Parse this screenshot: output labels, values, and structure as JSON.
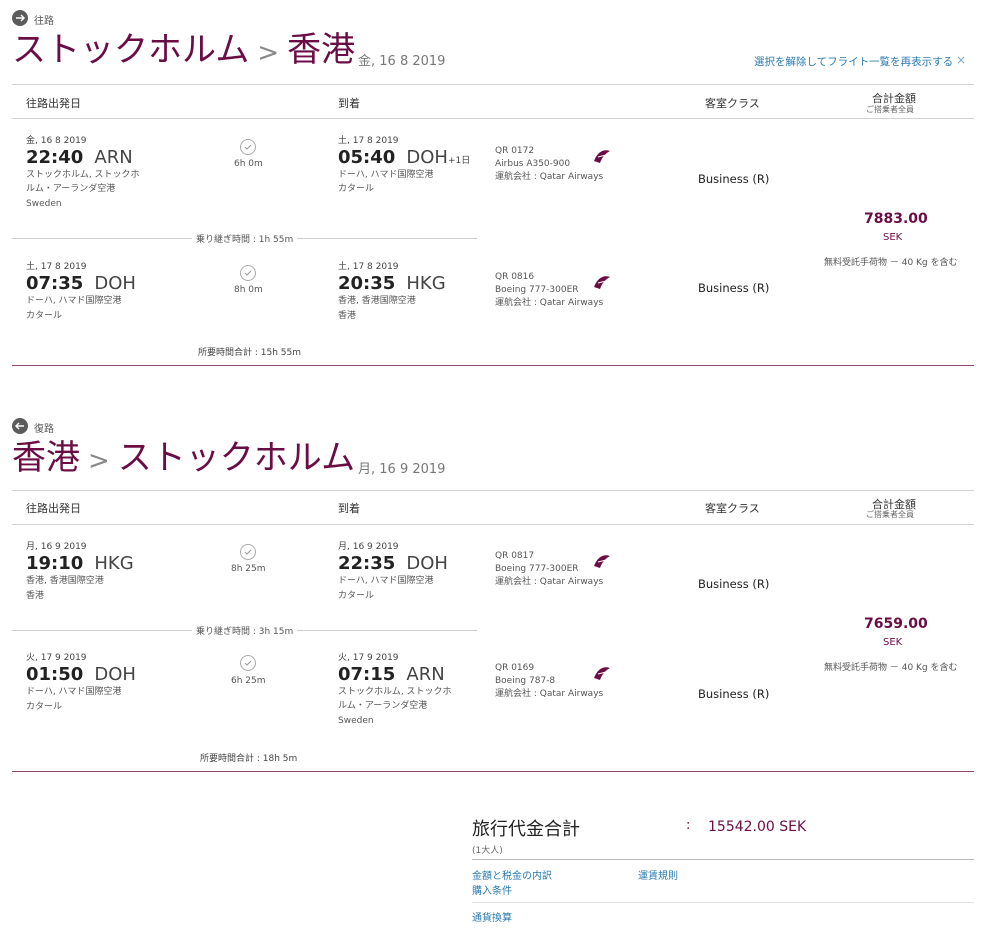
{
  "outbound": {
    "dir_label": "往路",
    "from": "ストックホルム",
    "sep": ">",
    "to": "香港",
    "date": "金, 16 8 2019",
    "reset_link": "選択を解除してフライト一覧を再表示する",
    "close": "×",
    "headers": {
      "depart": "往路出発日",
      "arrive": "到着",
      "cabin": "客室クラス",
      "total": "合計金額",
      "total_sub": "ご搭乗者全員"
    },
    "seg1": {
      "dep_date": "金, 16 8 2019",
      "dep_time": "22:40",
      "dep_code": "ARN",
      "dep_place1": "ストックホルム, ストックホ",
      "dep_place2": "ルム・アーランダ空港",
      "dep_country": "Sweden",
      "duration": "6h 0m",
      "arr_date": "土, 17 8 2019",
      "arr_time": "05:40",
      "arr_code": "DOH",
      "arr_plus": "+1日",
      "arr_place": "ドーハ, ハマド国際空港",
      "arr_country": "カタール",
      "flight_no": "QR 0172",
      "aircraft": "Airbus A350-900",
      "operator": "運航会社 : Qatar Airways",
      "cabin": "Business (R)"
    },
    "connection": "乗り継ぎ時間 : 1h 55m",
    "seg2": {
      "dep_date": "土, 17 8 2019",
      "dep_time": "07:35",
      "dep_code": "DOH",
      "dep_place1": "ドーハ, ハマド国際空港",
      "dep_country": "カタール",
      "duration": "8h 0m",
      "arr_date": "土, 17 8 2019",
      "arr_time": "20:35",
      "arr_code": "HKG",
      "arr_place": "香港, 香港国際空港",
      "arr_country": "香港",
      "flight_no": "QR 0816",
      "aircraft": "Boeing 777-300ER",
      "operator": "運航会社 : Qatar Airways",
      "cabin": "Business (R)"
    },
    "price": "7883.00",
    "currency": "SEK",
    "baggage": "無料受託手荷物 － 40 Kg を含む",
    "total_time": "所要時間合計 : 15h 55m"
  },
  "inbound": {
    "dir_label": "復路",
    "from": "香港",
    "sep": ">",
    "to": "ストックホルム",
    "date": "月, 16 9 2019",
    "headers": {
      "depart": "往路出発日",
      "arrive": "到着",
      "cabin": "客室クラス",
      "total": "合計金額",
      "total_sub": "ご搭乗者全員"
    },
    "seg1": {
      "dep_date": "月, 16 9 2019",
      "dep_time": "19:10",
      "dep_code": "HKG",
      "dep_place1": "香港, 香港国際空港",
      "dep_country": "香港",
      "duration": "8h 25m",
      "arr_date": "月, 16 9 2019",
      "arr_time": "22:35",
      "arr_code": "DOH",
      "arr_place": "ドーハ, ハマド国際空港",
      "arr_country": "カタール",
      "flight_no": "QR 0817",
      "aircraft": "Boeing 777-300ER",
      "operator": "運航会社 : Qatar Airways",
      "cabin": "Business (R)"
    },
    "connection": "乗り継ぎ時間 : 3h 15m",
    "seg2": {
      "dep_date": "火, 17 9 2019",
      "dep_time": "01:50",
      "dep_code": "DOH",
      "dep_place1": "ドーハ, ハマド国際空港",
      "dep_country": "カタール",
      "duration": "6h 25m",
      "arr_date": "火, 17 9 2019",
      "arr_time": "07:15",
      "arr_code": "ARN",
      "arr_place1": "ストックホルム, ストックホ",
      "arr_place2": "ルム・アーランダ空港",
      "arr_country": "Sweden",
      "flight_no": "QR 0169",
      "aircraft": "Boeing 787-8",
      "operator": "運航会社 : Qatar Airways",
      "cabin": "Business (R)"
    },
    "price": "7659.00",
    "currency": "SEK",
    "baggage": "無料受託手荷物 － 40 Kg を含む",
    "total_time": "所要時間合計 : 18h 5m"
  },
  "summary": {
    "label": "旅行代金合計",
    "colon": ":",
    "value": "15542.00 SEK",
    "passengers": "(1大人)",
    "link_breakdown": "金額と税金の内訳",
    "link_fare_rules": "運賃規則",
    "link_purchase": "購入条件",
    "link_currency": "通貨換算"
  },
  "colors": {
    "brand": "#6b0d45",
    "link": "#2b7bb0"
  }
}
